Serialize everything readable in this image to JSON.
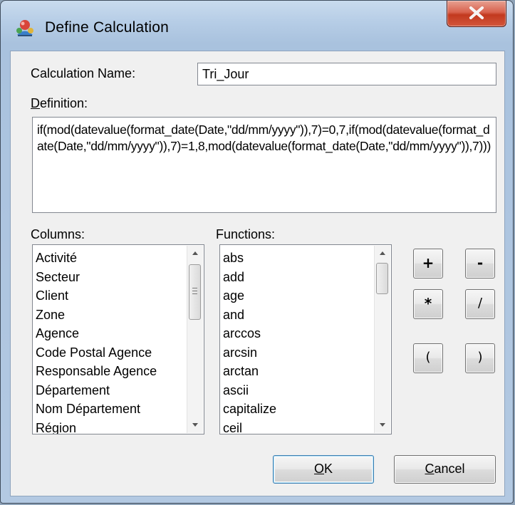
{
  "window": {
    "title": "Define Calculation"
  },
  "form": {
    "calc_name_label": "Calculation Name:",
    "calc_name_value": "Tri_Jour",
    "definition_label_first": "D",
    "definition_label_rest": "efinition:",
    "definition_value": "if(mod(datevalue(format_date(Date,\"dd/mm/yyyy\")),7)=0,7,if(mod(datevalue(format_date(Date,\"dd/mm/yyyy\")),7)=1,8,mod(datevalue(format_date(Date,\"dd/mm/yyyy\")),7)))"
  },
  "columns": {
    "label": "Columns:",
    "items": [
      "Activité",
      "Secteur",
      "Client",
      "Zone",
      "Agence",
      "Code Postal Agence",
      "Responsable Agence",
      "Département",
      "Nom Département",
      "Région"
    ]
  },
  "functions": {
    "label": "Functions:",
    "items": [
      "abs",
      "add",
      "age",
      "and",
      "arccos",
      "arcsin",
      "arctan",
      "ascii",
      "capitalize",
      "ceil"
    ]
  },
  "operators": {
    "plus": "+",
    "minus": "-",
    "multiply": "*",
    "divide": "/",
    "open_paren": "(",
    "close_paren": ")"
  },
  "buttons": {
    "ok_first": "O",
    "ok_rest": "K",
    "cancel_first": "C",
    "cancel_rest": "ancel"
  }
}
